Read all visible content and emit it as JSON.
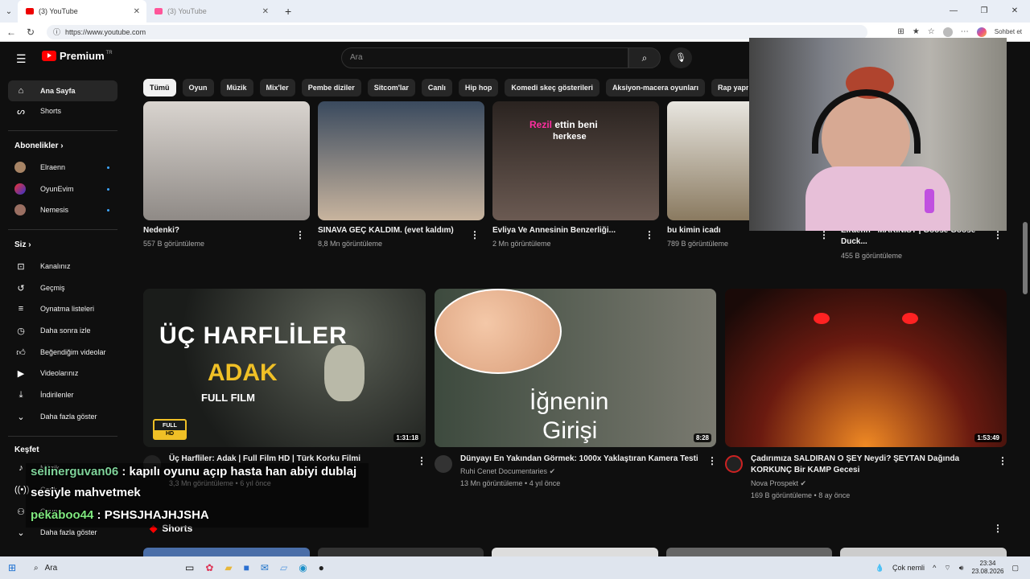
{
  "browser": {
    "tabs": [
      {
        "label": "(3) YouTube",
        "active": true
      },
      {
        "label": "(3) YouTube",
        "active": false
      }
    ],
    "url": "https://www.youtube.com",
    "sohbet": "Sohbet et"
  },
  "youtube": {
    "logo": "Premium",
    "logo_region": "TR",
    "search_placeholder": "Ara",
    "chips": [
      "Tümü",
      "Oyun",
      "Müzik",
      "Mix'ler",
      "Pembe diziler",
      "Sitcom'lar",
      "Canlı",
      "Hip hop",
      "Komedi skeç gösterileri",
      "Aksiyon-macera oyunları",
      "Rap yapma"
    ],
    "sidebar": {
      "home": "Ana Sayfa",
      "shorts": "Shorts",
      "subs_header": "Abonelikler",
      "subs": [
        "Elraenn",
        "OyunEvim",
        "Nemesis"
      ],
      "you_header": "Siz",
      "you_items": [
        "Kanalınız",
        "Geçmiş",
        "Oynatma listeleri",
        "Daha sonra izle",
        "Beğendiğim videolar",
        "Videolarınız",
        "İndirilenler",
        "Daha fazla göster"
      ],
      "explore_header": "Keşfet",
      "explore_items": [
        "Müzik",
        "Canlı",
        "Oyun",
        "Daha fazla göster"
      ]
    },
    "row1": [
      {
        "title": "Nedenki?",
        "meta": "557 B görüntüleme"
      },
      {
        "title": "SINAVA GEÇ KALDIM. (evet kaldım)",
        "meta": "8,8 Mn görüntüleme",
        "overlay": ""
      },
      {
        "title": "Evliya Ve Annesinin Benzerliği...",
        "meta": "2 Mn görüntüleme",
        "overlay1": "Rezil",
        "overlay2": "ettin beni",
        "overlay3": "herkese"
      },
      {
        "title": "bu kimin icadı",
        "meta": "789 B görüntüleme"
      },
      {
        "title": "Elraenn - MAKİNİST | Goose Goose Duck...",
        "meta": "455 B görüntüleme"
      }
    ],
    "row2": [
      {
        "title": "Üç Harfliler: Adak | Full Film HD | Türk Korku Filmi",
        "channel": "",
        "meta": "3,3 Mn görüntüleme • 6 yıl önce",
        "duration": "1:31:18",
        "thumb_line1": "ÜÇ HARFLİLER",
        "thumb_line2": "ADAK",
        "thumb_line3": "FULL FILM",
        "badge1": "FULL",
        "badge2": "HD"
      },
      {
        "title": "Dünyayı En Yakından Görmek: 1000x Yaklaştıran Kamera Testi",
        "channel": "Ruhi Cenet Documentaries",
        "meta": "13 Mn görüntüleme • 4 yıl önce",
        "duration": "8:28",
        "thumb_line1": "İğnenin",
        "thumb_line2": "Girişi"
      },
      {
        "title": "Çadırımıza SALDIRAN O ŞEY Neydi? ŞEYTAN Dağında KORKUNÇ Bir KAMP Gecesi",
        "channel": "Nova Prospekt",
        "meta": "169 B görüntüleme • 8 ay önce",
        "duration": "1:53:49"
      }
    ],
    "shorts_header": "Shorts"
  },
  "chat": [
    {
      "user": "selinerguvan06",
      "text": " : kapılı oyunu açıp hasta han abiyi dublaj"
    },
    {
      "user": "",
      "text": "sesiyle mahvetmek"
    },
    {
      "user": "pekaboo44",
      "text": " : PSHSJHAJHJSHA"
    }
  ],
  "taskbar": {
    "search": "Ara",
    "weather": "Çok nemli",
    "time": "23:34",
    "date": "23.08.2026"
  }
}
